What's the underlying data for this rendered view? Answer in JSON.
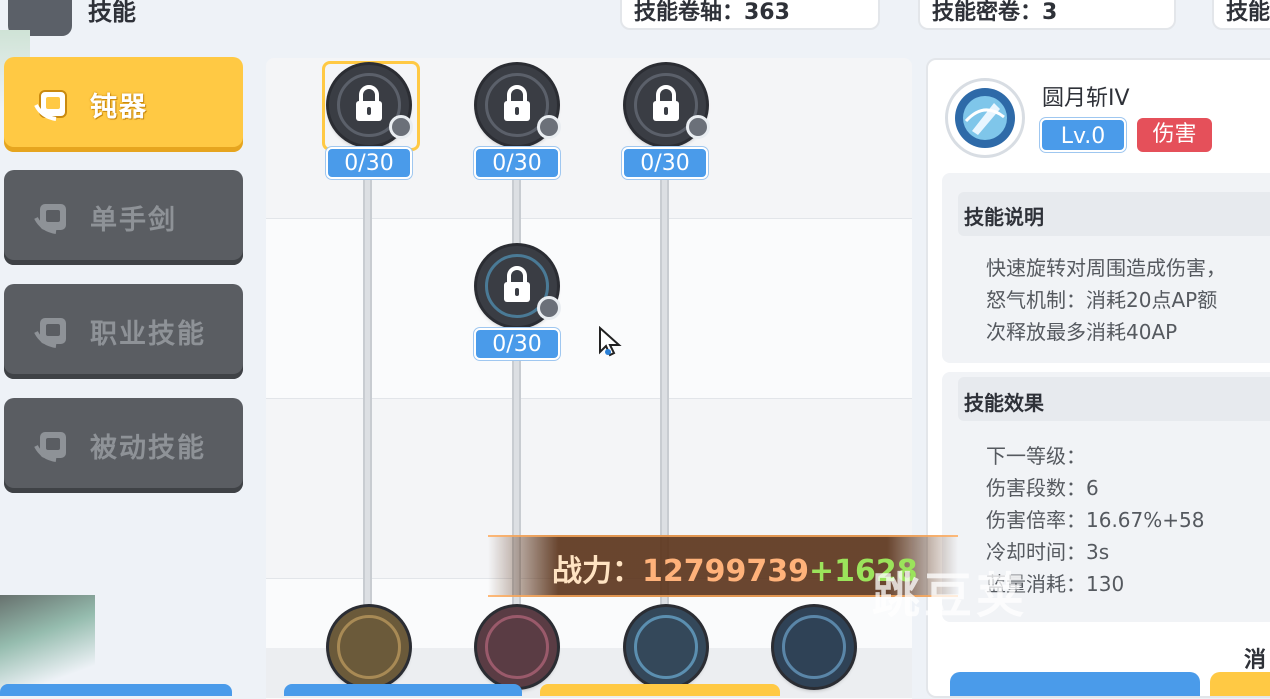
{
  "header": {
    "title": "技能",
    "resources": [
      {
        "label": "技能卷轴：363"
      },
      {
        "label": "技能密卷：3"
      },
      {
        "label": "技能"
      }
    ]
  },
  "tabs": [
    {
      "label": "钝器",
      "active": true
    },
    {
      "label": "单手剑",
      "active": false
    },
    {
      "label": "职业技能",
      "active": false
    },
    {
      "label": "被动技能",
      "active": false
    }
  ],
  "tree": {
    "nodes": [
      {
        "level": "0/30"
      },
      {
        "level": "0/30"
      },
      {
        "level": "0/30"
      },
      {
        "level": "0/30"
      }
    ]
  },
  "skill": {
    "name": "圆月斩IV",
    "level": "Lv.0",
    "tag": "伤害",
    "desc_header": "技能说明",
    "desc_lines": [
      "快速旋转对周围造成伤害，",
      "怒气机制：消耗20点AP额",
      "次释放最多消耗40AP"
    ],
    "effect_header": "技能效果",
    "effect_lines": [
      "下一等级：",
      "伤害段数：6",
      "伤害倍率：16.67%+58",
      "冷却时间：3s",
      "蓝量消耗：130"
    ],
    "bottom_label": "消"
  },
  "combat_power": {
    "label": "战力：",
    "value": "12799739",
    "delta": "+1628"
  },
  "watermark": "跳豆荚",
  "colors": {
    "tab_active": "#ffc944",
    "tab_inactive": "#5a5d62",
    "level_badge": "#4a9bea",
    "tag_red": "#e5505a",
    "power_value": "#ffb27a",
    "power_delta": "#9be35b"
  }
}
